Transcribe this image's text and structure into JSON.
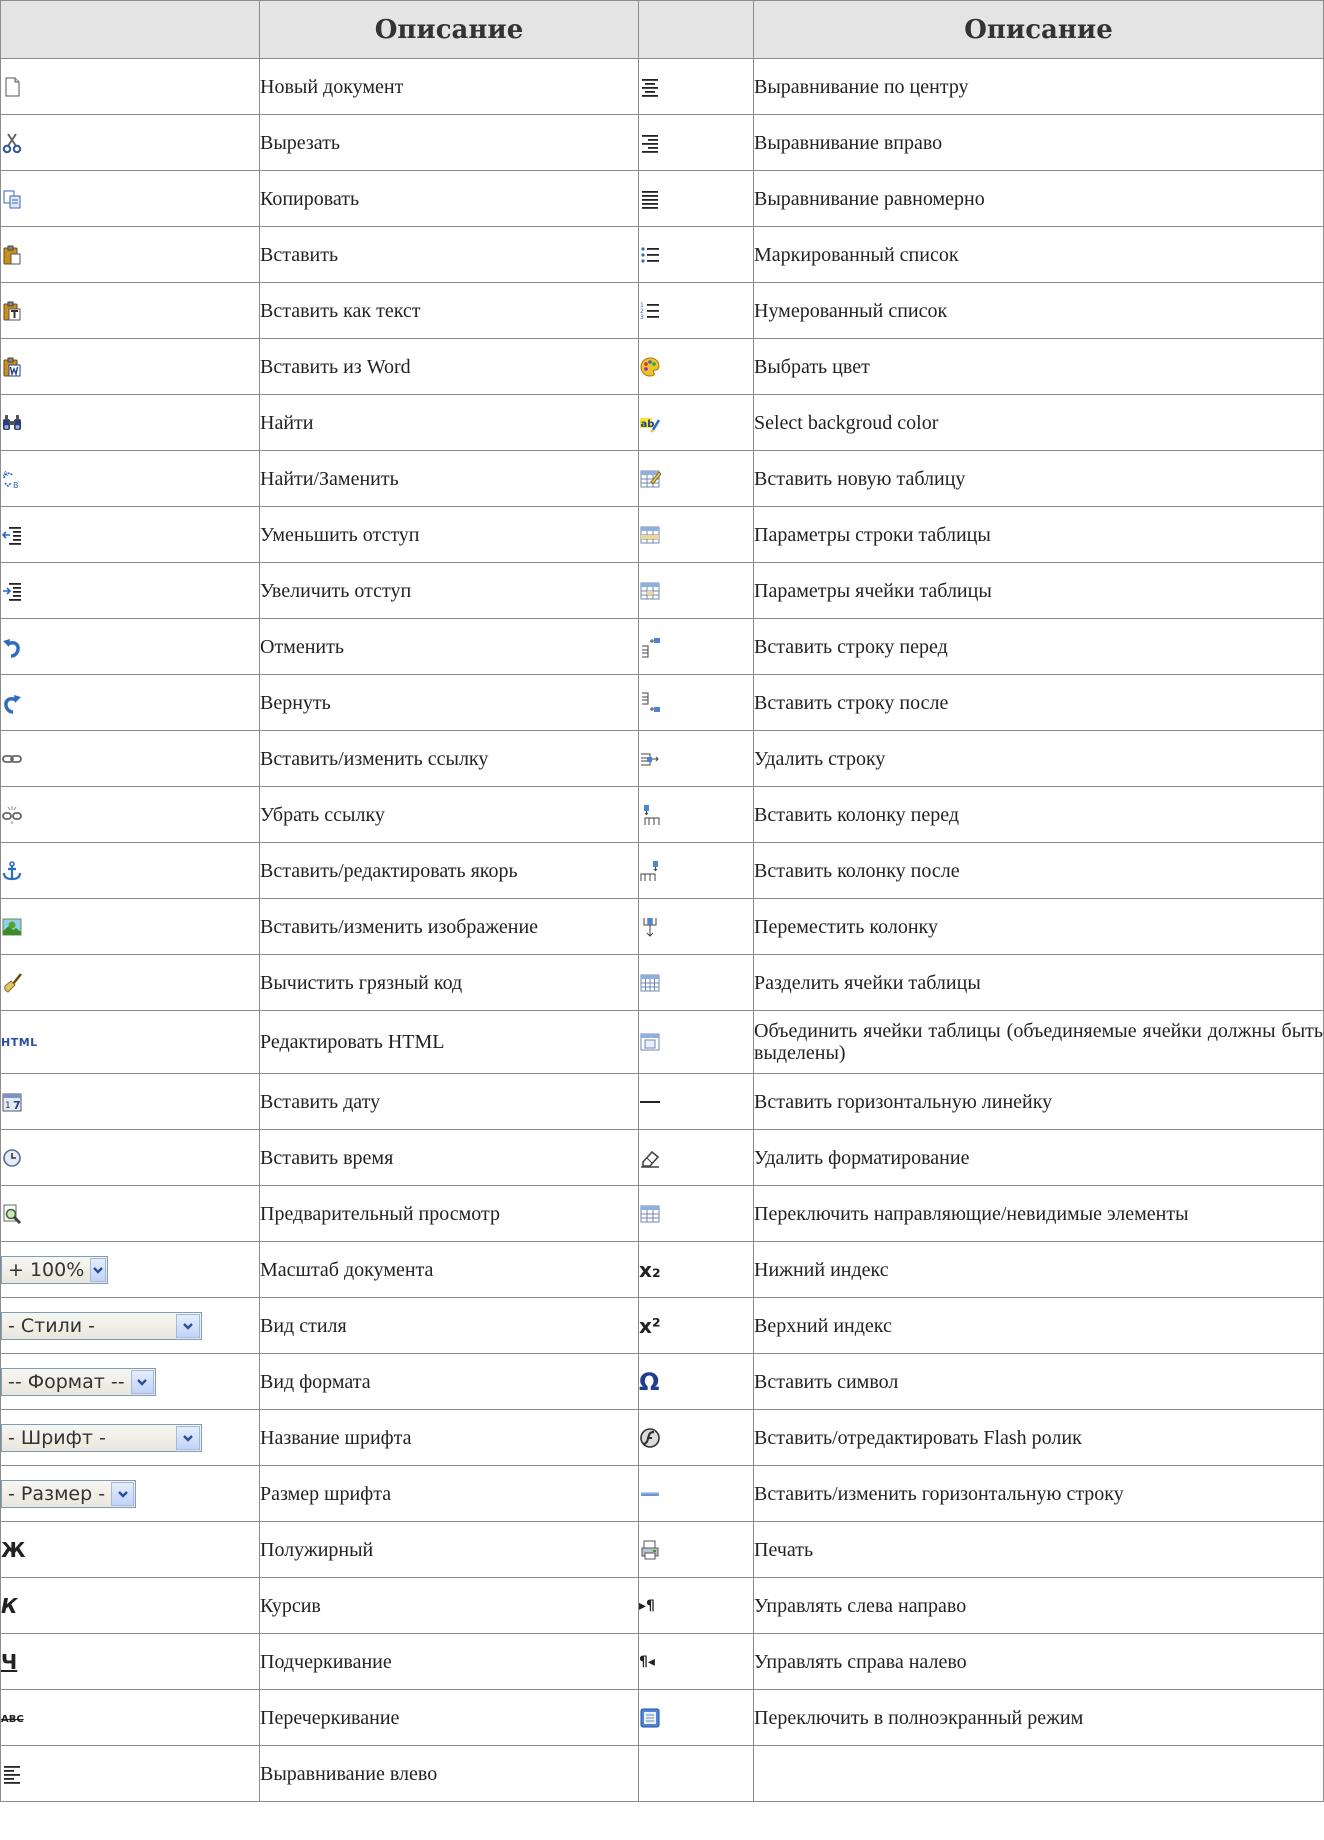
{
  "header": {
    "col1": "",
    "col2": "Описание",
    "col3": "",
    "col4": "Описание"
  },
  "rows": [
    {
      "left": {
        "icon": "new-document-icon",
        "label": "Новый документ"
      },
      "right": {
        "icon": "align-center-icon",
        "label": "Выравнивание по центру"
      }
    },
    {
      "left": {
        "icon": "cut-icon",
        "label": "Вырезать"
      },
      "right": {
        "icon": "align-right-icon",
        "label": "Выравнивание вправо"
      }
    },
    {
      "left": {
        "icon": "copy-icon",
        "label": "Копировать"
      },
      "right": {
        "icon": "align-justify-icon",
        "label": "Выравнивание равномерно"
      }
    },
    {
      "left": {
        "icon": "paste-icon",
        "label": "Вставить"
      },
      "right": {
        "icon": "bulleted-list-icon",
        "label": "Маркированный список"
      }
    },
    {
      "left": {
        "icon": "paste-text-icon",
        "label": "Вставить как текст"
      },
      "right": {
        "icon": "numbered-list-icon",
        "label": "Нумерованный список"
      }
    },
    {
      "left": {
        "icon": "paste-word-icon",
        "label": "Вставить из Word"
      },
      "right": {
        "icon": "color-palette-icon",
        "label": "Выбрать цвет"
      }
    },
    {
      "left": {
        "icon": "find-icon",
        "label": "Найти"
      },
      "right": {
        "icon": "background-color-icon",
        "label": "Select backgroud color"
      }
    },
    {
      "left": {
        "icon": "find-replace-icon",
        "label": "Найти/Заменить"
      },
      "right": {
        "icon": "insert-table-icon",
        "label": "Вставить новую таблицу"
      }
    },
    {
      "left": {
        "icon": "outdent-icon",
        "label": "Уменьшить отступ"
      },
      "right": {
        "icon": "table-row-props-icon",
        "label": "Параметры строки таблицы"
      }
    },
    {
      "left": {
        "icon": "indent-icon",
        "label": "Увеличить отступ"
      },
      "right": {
        "icon": "table-cell-props-icon",
        "label": "Параметры ячейки таблицы"
      }
    },
    {
      "left": {
        "icon": "undo-icon",
        "label": "Отменить"
      },
      "right": {
        "icon": "row-before-icon",
        "label": "Вставить строку перед"
      }
    },
    {
      "left": {
        "icon": "redo-icon",
        "label": "Вернуть"
      },
      "right": {
        "icon": "row-after-icon",
        "label": "Вставить строку после"
      }
    },
    {
      "left": {
        "icon": "link-icon",
        "label": "Вставить/изменить ссылку"
      },
      "right": {
        "icon": "delete-row-icon",
        "label": "Удалить строку"
      }
    },
    {
      "left": {
        "icon": "unlink-icon",
        "label": "Убрать ссылку"
      },
      "right": {
        "icon": "col-before-icon",
        "label": "Вставить колонку перед"
      }
    },
    {
      "left": {
        "icon": "anchor-icon",
        "label": "Вставить/редактировать якорь"
      },
      "right": {
        "icon": "col-after-icon",
        "label": "Вставить колонку после"
      }
    },
    {
      "left": {
        "icon": "image-icon",
        "label": "Вставить/изменить изображение"
      },
      "right": {
        "icon": "move-column-icon",
        "label": "Переместить колонку"
      }
    },
    {
      "left": {
        "icon": "cleanup-icon",
        "label": "Вычистить грязный код"
      },
      "right": {
        "icon": "split-cells-icon",
        "label": "Разделить ячейки таблицы"
      }
    },
    {
      "left": {
        "icon": "html-icon",
        "text": "HTML",
        "label": "Редактировать HTML"
      },
      "right": {
        "icon": "merge-cells-icon",
        "label": "Объединить ячейки таблицы (объединяемые ячейки должны быть выделены)"
      },
      "tall": true
    },
    {
      "left": {
        "icon": "insert-date-icon",
        "label": "Вставить дату"
      },
      "right": {
        "icon": "horizontal-rule-icon",
        "label": "Вставить горизонтальную линейку"
      }
    },
    {
      "left": {
        "icon": "insert-time-icon",
        "label": "Вставить время"
      },
      "right": {
        "icon": "remove-format-icon",
        "label": "Удалить форматирование"
      }
    },
    {
      "left": {
        "icon": "preview-icon",
        "label": "Предварительный просмотр"
      },
      "right": {
        "icon": "visual-aid-icon",
        "label": "Переключить направляющие/невидимые элементы"
      }
    },
    {
      "left": {
        "combo": "+ 100%",
        "label": "Масштаб документа"
      },
      "right": {
        "icon": "subscript-icon",
        "text": "x₂",
        "label": "Нижний индекс"
      }
    },
    {
      "left": {
        "combo": "- Стили -",
        "label": "Вид стиля"
      },
      "right": {
        "icon": "superscript-icon",
        "text": "x²",
        "label": "Верхний индекс"
      }
    },
    {
      "left": {
        "combo": "-- Формат --",
        "label": "Вид формата"
      },
      "right": {
        "icon": "omega-icon",
        "text": "Ω",
        "label": "Вставить символ"
      }
    },
    {
      "left": {
        "combo": "- Шрифт -",
        "label": "Название шрифта"
      },
      "right": {
        "icon": "flash-icon",
        "label": "Вставить/отредактировать Flash ролик"
      }
    },
    {
      "left": {
        "combo": "- Размер -",
        "label": "Размер шрифта"
      },
      "right": {
        "icon": "horizontal-line-icon",
        "label": "Вставить/изменить горизонтальную строку"
      }
    },
    {
      "left": {
        "icon": "bold-icon",
        "text": "Ж",
        "label": "Полужирный"
      },
      "right": {
        "icon": "print-icon",
        "label": "Печать"
      }
    },
    {
      "left": {
        "icon": "italic-icon",
        "text": "К",
        "label": "Курсив"
      },
      "right": {
        "icon": "ltr-icon",
        "text": "▸¶",
        "label": "Управлять слева направо"
      }
    },
    {
      "left": {
        "icon": "underline-icon",
        "text": "Ч",
        "label": "Подчеркивание"
      },
      "right": {
        "icon": "rtl-icon",
        "text": "¶◂",
        "label": "Управлять справа налево"
      }
    },
    {
      "left": {
        "icon": "strikethrough-icon",
        "text": "ABC",
        "label": "Перечеркивание"
      },
      "right": {
        "icon": "fullscreen-icon",
        "label": "Переключить в полноэкранный режим"
      }
    },
    {
      "left": {
        "icon": "align-left-icon",
        "label": "Выравнивание влево"
      },
      "right": {
        "icon": "",
        "label": ""
      }
    }
  ]
}
